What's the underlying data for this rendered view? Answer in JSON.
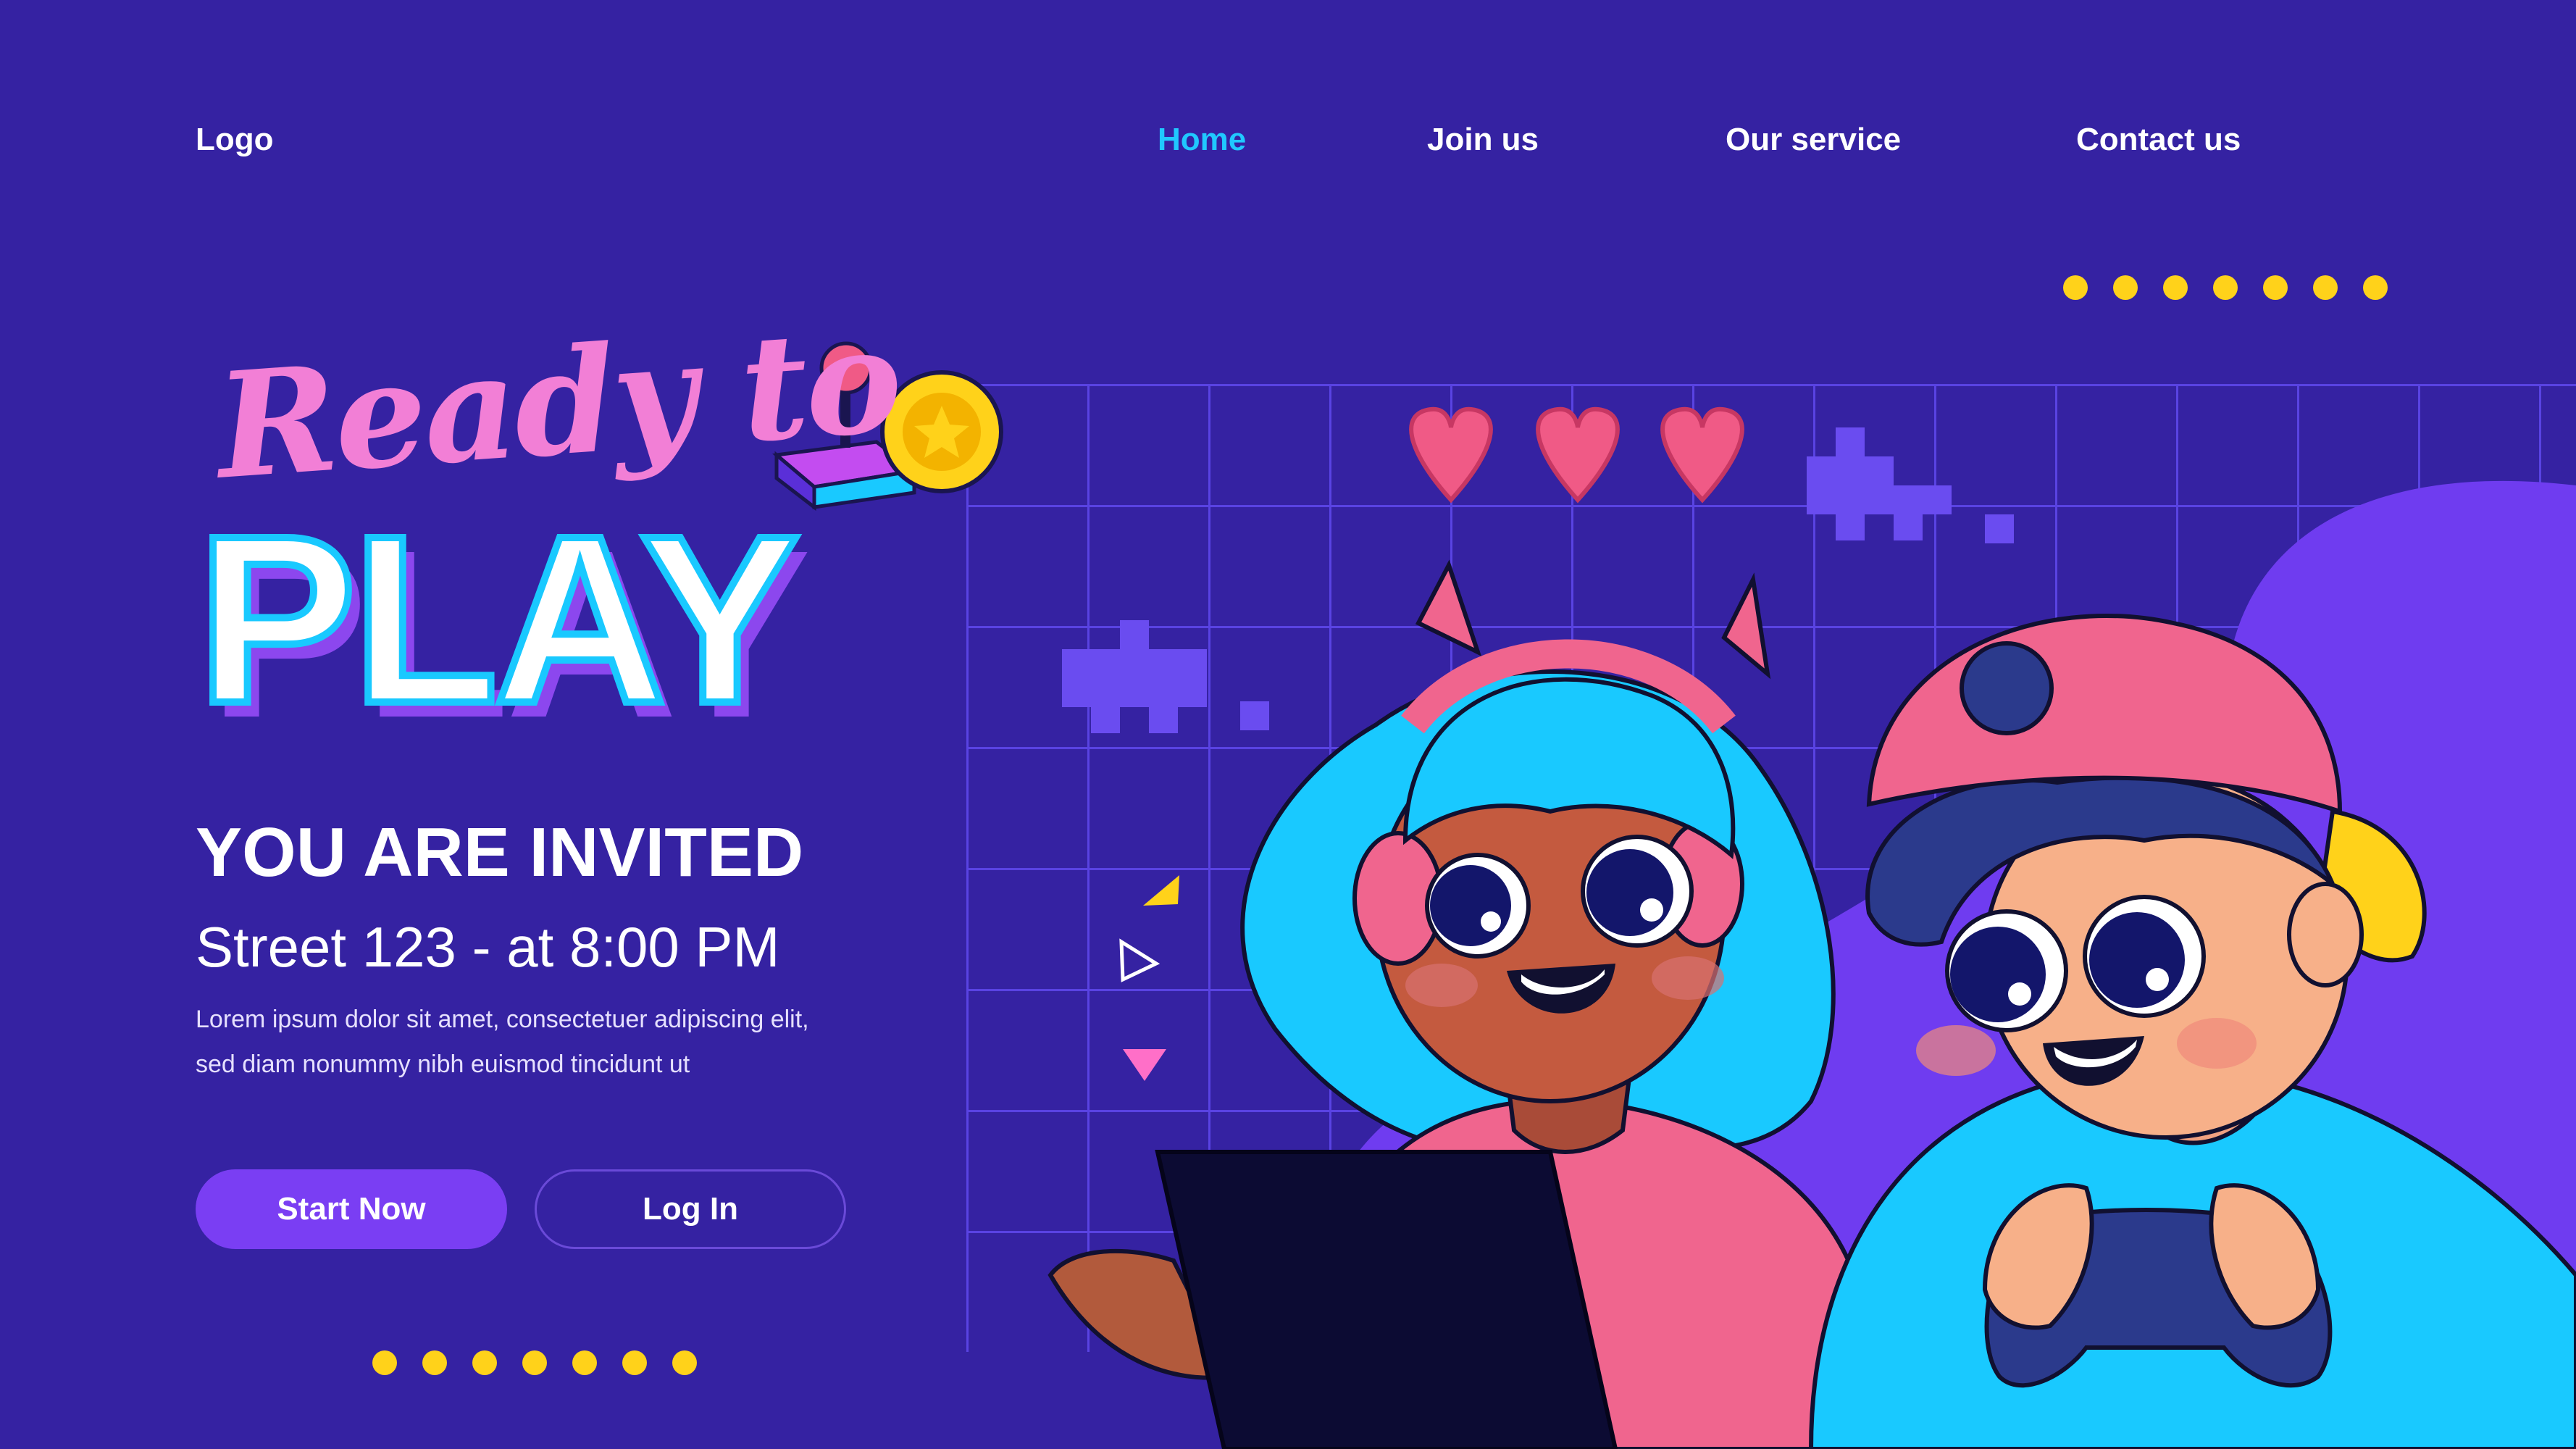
{
  "nav": {
    "logo": "Logo",
    "items": [
      {
        "label": "Home",
        "active": true
      },
      {
        "label": "Join us"
      },
      {
        "label": "Our service"
      },
      {
        "label": "Contact us"
      }
    ]
  },
  "hero": {
    "script_title": "Ready to",
    "title": "PLAY",
    "subtitle": "YOU ARE INVITED",
    "address": "Street 123 - at 8:00 PM",
    "description": "Lorem ipsum dolor sit amet, consectetuer adipiscing elit, sed diam nonummy nibh euismod tincidunt ut"
  },
  "buttons": {
    "start": "Start Now",
    "login": "Log In"
  },
  "colors": {
    "background": "#3522a2",
    "active_nav": "#20c8ff",
    "accent_button": "#7a3ef3",
    "dots": "#ffd21a",
    "script_pink": "#f27fd6"
  },
  "icons": [
    "joystick-icon",
    "coin-icon",
    "heart-icon",
    "space-invader-icon",
    "triangle-icon"
  ],
  "health_hearts": 3
}
